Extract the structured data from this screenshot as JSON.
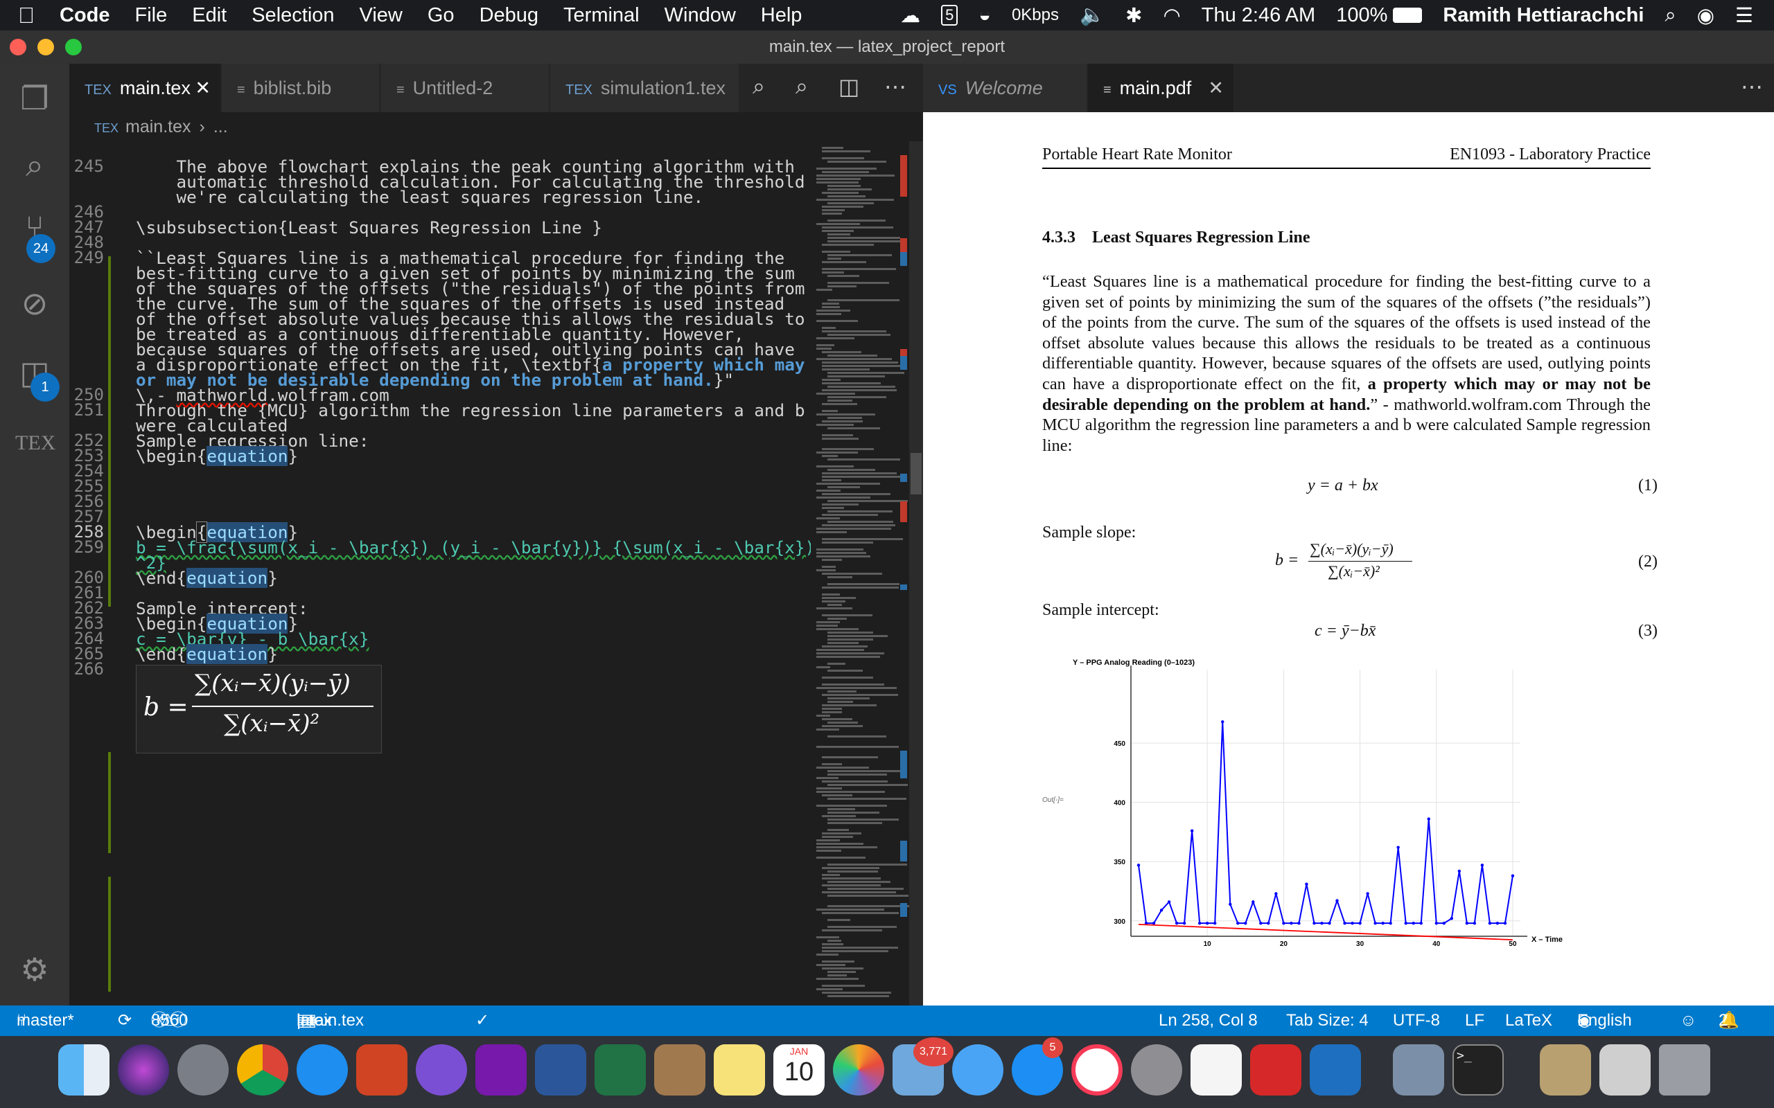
{
  "menubar": {
    "app": "Code",
    "items": [
      "File",
      "Edit",
      "Selection",
      "View",
      "Go",
      "Debug",
      "Terminal",
      "Window",
      "Help"
    ],
    "netspeed": "0Kbps",
    "clock": "Thu 2:46 AM",
    "battery": "100%",
    "user": "Ramith Hettiarachchi"
  },
  "window": {
    "title": "main.tex — latex_project_report"
  },
  "activity": {
    "scm_badge": "24",
    "ext_badge": "1",
    "tex_label": "TEX"
  },
  "editor": {
    "tabs": [
      {
        "label": "main.tex",
        "icon": "TEX",
        "active": true
      },
      {
        "label": "biblist.bib",
        "icon": "≡"
      },
      {
        "label": "Untitled-2",
        "icon": "≡"
      },
      {
        "label": "simulation1.tex",
        "icon": "TEX"
      }
    ],
    "breadcrumb": {
      "file": "main.tex",
      "more": "..."
    },
    "line_numbers": [
      "245",
      "246",
      "247",
      "248",
      "249",
      "250",
      "251",
      "252",
      "253",
      "254",
      "255",
      "256",
      "257",
      "258",
      "259",
      "260",
      "261",
      "262",
      "263",
      "264",
      "265",
      "266"
    ],
    "lines": {
      "l245a": "    The above flowchart explains the peak counting algorithm with",
      "l245b": "    automatic threshold calculation. For calculating the threshold",
      "l245c": "    we're calculating the least squares regression line.",
      "l247_cmd": "\\subsubsection",
      "l247_arg": "{Least Squares Regression Line }",
      "l249a": "``Least Squares line is a mathematical procedure for finding the",
      "l249b": "best-fitting curve to a given set of points by minimizing the sum",
      "l249c": "of the squares of the offsets (\"the residuals\") of the points from",
      "l249d": "the curve. The sum of the squares of the offsets is used instead",
      "l249e": "of the offset absolute values because this allows the residuals to",
      "l249f": "be treated as a continuous differentiable quantity. However,",
      "l249g": "because squares of the offsets are used, outlying points can have",
      "l249h_pre": "a disproportionate effect on the fit, \\textbf{",
      "l249h_bold": "a property which may",
      "l249i_bold": "or may not be desirable depending on the problem at hand.",
      "l249i_post": "}\"",
      "l250_pre": "\\,- ",
      "l250_url": "mathworld",
      "l250_post": ".wolfram.com",
      "l251a": "Through the {MCU} algorithm the regression line parameters a and b",
      "l251b": "were calculated",
      "l252": "Sample regression line:",
      "begin": "\\begin",
      "end": "\\end",
      "env": "equation",
      "brace_open": "{",
      "brace_close": "}",
      "l259a": "b = \\frac{\\sum(x_i - \\bar{x}) (y_i - \\bar{y})} {\\sum(x_i - \\bar{x})",
      "l259b": "^2}",
      "l262": "Sample intercept:",
      "l264": "c = \\bar{y} - b \\bar{x}"
    },
    "hover_equation": {
      "lhs": "b =",
      "num": "∑(xᵢ−x̄)(yᵢ−ȳ)",
      "den": "∑(xᵢ−x̄)²"
    }
  },
  "pdf": {
    "tabs": [
      {
        "label": "Welcome",
        "icon": "VS"
      },
      {
        "label": "main.pdf",
        "icon": "≡"
      }
    ],
    "header_left": "Portable Heart Rate Monitor",
    "header_right": "EN1093 - Laboratory Practice",
    "section_num": "4.3.3",
    "section_title": "Least Squares Regression Line",
    "para_normal": "“Least Squares line is a mathematical procedure for finding the best-fitting curve to a given set of points by minimizing the sum of the squares of the offsets (”the residuals”) of the points from the curve. The sum of the squares of the offsets is used instead of the offset absolute values because this allows the residuals to be treated as a continuous differentiable quantity. However, because squares of the offsets are used, outlying points can have a disproportionate effect on the fit, ",
    "para_bold": "a property which may or may not be desirable depending on the problem at hand.",
    "para_tail": "” - mathworld.wolfram.com Through the MCU algorithm the regression line parameters a and b were calculated Sample regression line:",
    "eq1": "y = a + bx",
    "eq1_num": "(1)",
    "slope_label": "Sample slope:",
    "eq2_lhs": "b =",
    "eq2_num_text": "∑(xᵢ−x̄)(yᵢ−ȳ)",
    "eq2_den_text": "∑(xᵢ−x̄)²",
    "eq2_num": "(2)",
    "intercept_label": "Sample intercept:",
    "eq3": "c = ȳ−bx̄",
    "eq3_num": "(3)",
    "out_label": "Out[-]="
  },
  "chart_data": {
    "type": "line",
    "title": "",
    "ylabel": "Y – PPG Analog Reading (0–1023)",
    "xlabel": "X – Time",
    "xlim": [
      0,
      51
    ],
    "ylim": [
      287,
      512
    ],
    "xticks": [
      10,
      20,
      30,
      40,
      50
    ],
    "yticks": [
      300,
      350,
      400,
      450
    ],
    "grid": true,
    "series": [
      {
        "color": "#0000ff",
        "x": [
          1,
          2,
          3,
          4,
          5,
          6,
          7,
          8,
          9,
          10,
          11,
          12,
          13,
          14,
          15,
          16,
          17,
          18,
          19,
          20,
          21,
          22,
          23,
          24,
          25,
          26,
          27,
          28,
          29,
          30,
          31,
          32,
          33,
          34,
          35,
          36,
          37,
          38,
          39,
          40,
          41,
          42,
          43,
          44,
          45,
          46,
          47,
          48,
          49,
          50
        ],
        "y": [
          347,
          298,
          298,
          309,
          316,
          298,
          298,
          376,
          298,
          298,
          298,
          468,
          314,
          298,
          298,
          316,
          298,
          298,
          323,
          298,
          298,
          298,
          331,
          298,
          298,
          298,
          317,
          298,
          298,
          298,
          323,
          298,
          298,
          298,
          362,
          298,
          298,
          298,
          386,
          298,
          298,
          302,
          342,
          298,
          298,
          347,
          298,
          298,
          298,
          338
        ]
      },
      {
        "color": "#ff0000",
        "x": [
          1,
          50
        ],
        "y": [
          297,
          284
        ]
      }
    ]
  },
  "statusbar": {
    "branch": "master*",
    "errors": "85",
    "warnings": "5",
    "infos": "60",
    "tex_project": "latex",
    "tex_file": "main.tex",
    "position": "Ln 258, Col 8",
    "tab_size": "Tab Size: 4",
    "encoding": "UTF-8",
    "eol": "LF",
    "language": "LaTeX",
    "spell": "English",
    "notifications": "2"
  },
  "dock": {
    "calendar_month": "JAN",
    "calendar_day": "10",
    "badge_photos": "3,771",
    "badge_appstore": "5"
  }
}
